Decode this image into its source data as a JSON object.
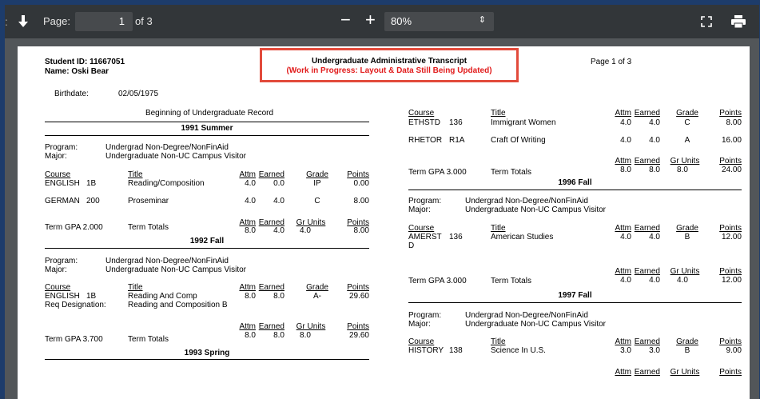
{
  "toolbar": {
    "page_label": "Page:",
    "page_value": "1",
    "page_of": "of 3",
    "zoom_out": "−",
    "zoom_in": "+",
    "zoom_value": "80%"
  },
  "header": {
    "student_id": "Student ID: 11667051",
    "name": "Name:  Oski Bear",
    "title": "Undergraduate Administrative Transcript",
    "wip": "(Work in Progress: Layout & Data Still Being Updated)",
    "page": "Page 1 of 3",
    "birthdate_label": "Birthdate:",
    "birthdate": "02/05/1975",
    "beginning": "Beginning of Undergraduate Record"
  },
  "cols": {
    "course": "Course",
    "title": "Title",
    "attm": "Attm",
    "earned": "Earned",
    "grade": "Grade",
    "points": "Points",
    "gr_units": "Gr Units",
    "term_totals": "Term Totals",
    "program": "Program:",
    "major": "Major:",
    "program_val": "Undergrad Non-Degree/NonFinAid",
    "major_val": "Undergraduate Non-UC Campus Visitor",
    "req_designation": "Req Designation:"
  },
  "left": {
    "t1_title": "1991 Summer",
    "t1_rows": [
      {
        "dept": "ENGLISH",
        "num": "1B",
        "title": "Reading/Composition",
        "attm": "4.0",
        "earned": "0.0",
        "grade": "IP",
        "points": "0.00"
      },
      {
        "dept": "GERMAN",
        "num": "200",
        "title": "Proseminar",
        "attm": "4.0",
        "earned": "4.0",
        "grade": "C",
        "points": "8.00"
      }
    ],
    "t1_gpa": "Term GPA  2.000",
    "t1_tot": {
      "attm": "8.0",
      "earned": "4.0",
      "gr": "4.0",
      "points": "8.00"
    },
    "t2_title": "1992 Fall",
    "t2_row": {
      "dept": "ENGLISH",
      "num": "1B",
      "title": "Reading And Comp",
      "attm": "8.0",
      "earned": "8.0",
      "grade": "A-",
      "points": "29.60"
    },
    "t2_req": "Reading and Composition B",
    "t2_gpa": "Term GPA  3.700",
    "t2_tot": {
      "attm": "8.0",
      "earned": "8.0",
      "gr": "8.0",
      "points": "29.60"
    },
    "t3_title": "1993 Spring"
  },
  "right": {
    "rows0": [
      {
        "dept": "ETHSTD",
        "num": "136",
        "title": "Immigrant Women",
        "attm": "4.0",
        "earned": "4.0",
        "grade": "C",
        "points": "8.00"
      },
      {
        "dept": "RHETOR",
        "num": "R1A",
        "title": "Craft Of Writing",
        "attm": "4.0",
        "earned": "4.0",
        "grade": "A",
        "points": "16.00"
      }
    ],
    "t0_gpa": "Term GPA  3.000",
    "t0_tot": {
      "attm": "8.0",
      "earned": "8.0",
      "gr": "8.0",
      "points": "24.00"
    },
    "t1_title": "1996 Fall",
    "t1_row": {
      "dept": "AMERST",
      "dept2": "D",
      "num": "136",
      "title": "American Studies",
      "attm": "4.0",
      "earned": "4.0",
      "grade": "B",
      "points": "12.00"
    },
    "t1_gpa": "Term GPA  3.000",
    "t1_tot": {
      "attm": "4.0",
      "earned": "4.0",
      "gr": "4.0",
      "points": "12.00"
    },
    "t2_title": "1997 Fall",
    "t2_row": {
      "dept": "HISTORY",
      "num": "138",
      "title": "Science In U.S.",
      "attm": "3.0",
      "earned": "3.0",
      "grade": "B",
      "points": "9.00"
    }
  }
}
